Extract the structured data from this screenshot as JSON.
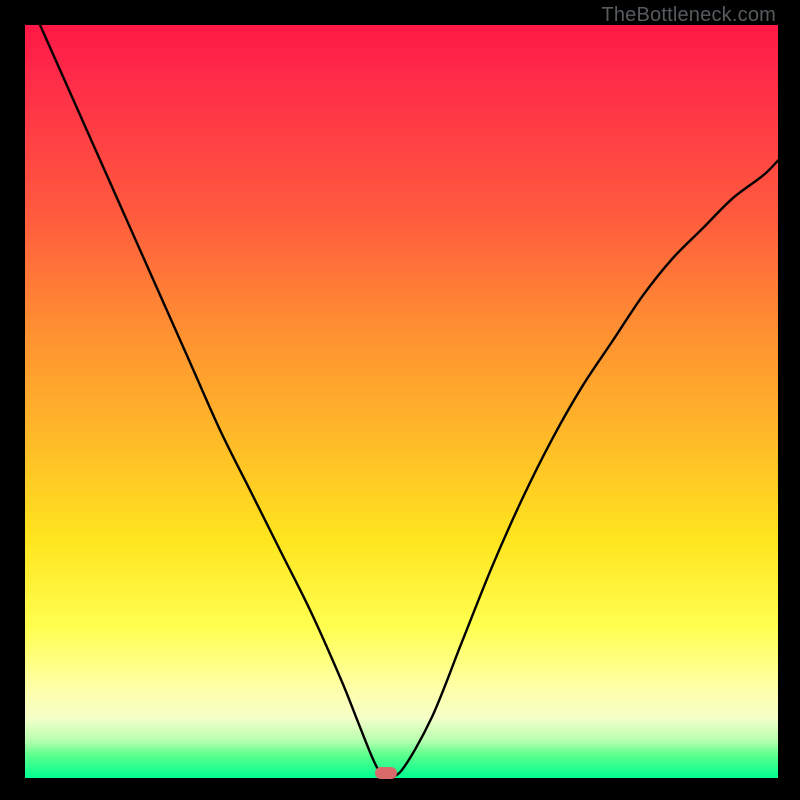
{
  "watermark": "TheBottleneck.com",
  "chart_data": {
    "type": "line",
    "title": "",
    "xlabel": "",
    "ylabel": "",
    "xlim": [
      0,
      100
    ],
    "ylim": [
      0,
      100
    ],
    "series": [
      {
        "name": "bottleneck-curve",
        "x": [
          2,
          6,
          10,
          14,
          18,
          22,
          26,
          30,
          34,
          38,
          42,
          44,
          46,
          47,
          48,
          50,
          54,
          58,
          62,
          66,
          70,
          74,
          78,
          82,
          86,
          90,
          94,
          98,
          100
        ],
        "y": [
          100,
          91,
          82,
          73,
          64,
          55,
          46,
          38,
          30,
          22,
          13,
          8,
          3,
          1,
          0.5,
          1,
          8,
          18,
          28,
          37,
          45,
          52,
          58,
          64,
          69,
          73,
          77,
          80,
          82
        ]
      }
    ],
    "marker": {
      "x": 48,
      "y": 0.6,
      "color": "#d96a6a"
    },
    "background_gradient": {
      "stops": [
        {
          "pos": 0.0,
          "color": "#ff1846"
        },
        {
          "pos": 0.25,
          "color": "#ff5a3e"
        },
        {
          "pos": 0.55,
          "color": "#ffba28"
        },
        {
          "pos": 0.8,
          "color": "#ffff50"
        },
        {
          "pos": 0.95,
          "color": "#b8ffb0"
        },
        {
          "pos": 1.0,
          "color": "#00ff90"
        }
      ]
    }
  }
}
